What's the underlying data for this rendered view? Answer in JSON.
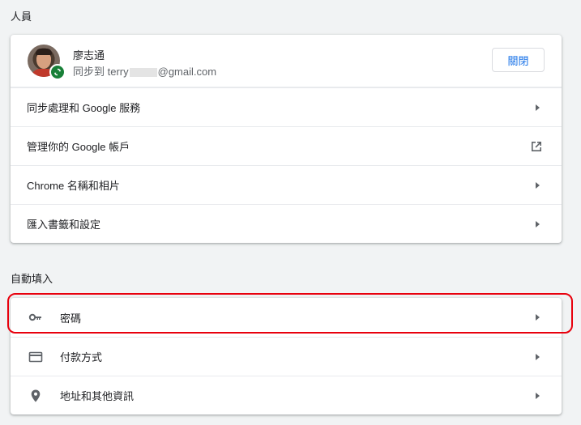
{
  "people": {
    "section_title": "人員",
    "profile": {
      "name": "廖志通",
      "sync_prefix": "同步到 terry",
      "sync_suffix": "@gmail.com",
      "close_button": "關閉"
    },
    "items": [
      {
        "label": "同步處理和 Google 服務",
        "trailing": "arrow"
      },
      {
        "label": "管理你的 Google 帳戶",
        "trailing": "external-link"
      },
      {
        "label": "Chrome 名稱和相片",
        "trailing": "arrow"
      },
      {
        "label": "匯入書籤和設定",
        "trailing": "arrow"
      }
    ]
  },
  "autofill": {
    "section_title": "自動填入",
    "items": [
      {
        "label": "密碼",
        "icon": "key-icon"
      },
      {
        "label": "付款方式",
        "icon": "credit-card-icon"
      },
      {
        "label": "地址和其他資訊",
        "icon": "location-pin-icon"
      }
    ]
  },
  "colors": {
    "accent": "#1a73e8",
    "sync_badge": "#188038",
    "highlight": "#e8000d",
    "background": "#f1f3f4"
  }
}
